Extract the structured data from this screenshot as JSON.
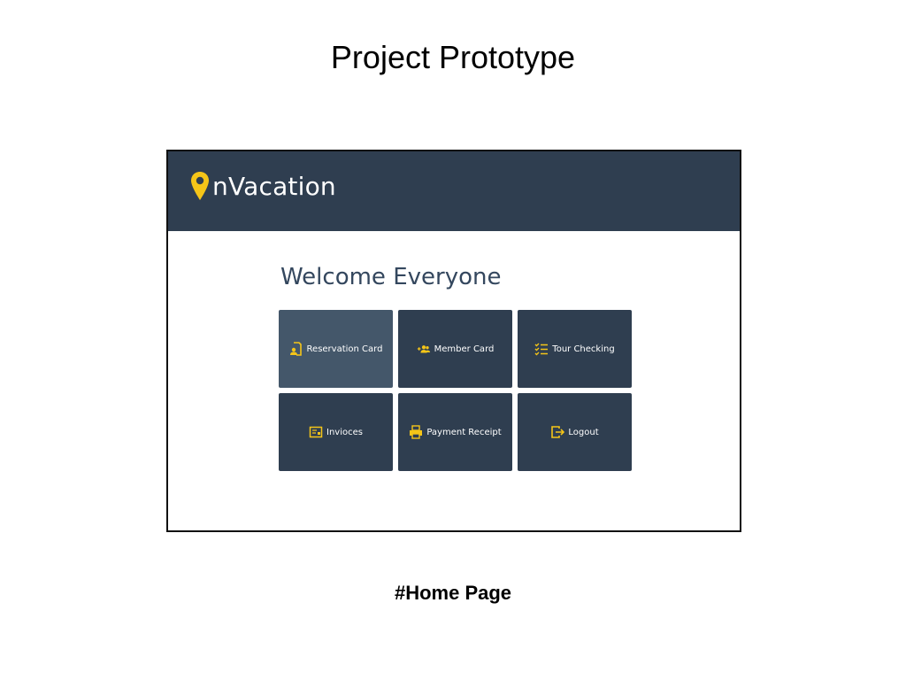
{
  "slide": {
    "title": "Project Prototype",
    "caption": "#Home Page"
  },
  "app": {
    "brand_suffix": "nVacation",
    "brand_icon": "location-pin-icon",
    "welcome": "Welcome Everyone",
    "colors": {
      "header": "#2f3e50",
      "tile": "#2f3e50",
      "tile_active": "#44576a",
      "accent": "#f5c518",
      "welcome_text": "#34475e"
    },
    "tiles": [
      {
        "label": "Reservation Card",
        "icon": "reservation-card-icon"
      },
      {
        "label": "Member Card",
        "icon": "member-group-icon"
      },
      {
        "label": "Tour Checking",
        "icon": "checklist-icon"
      },
      {
        "label": "Invioces",
        "icon": "invoice-icon"
      },
      {
        "label": "Payment Receipt",
        "icon": "printer-receipt-icon"
      },
      {
        "label": "Logout",
        "icon": "logout-icon"
      }
    ]
  }
}
